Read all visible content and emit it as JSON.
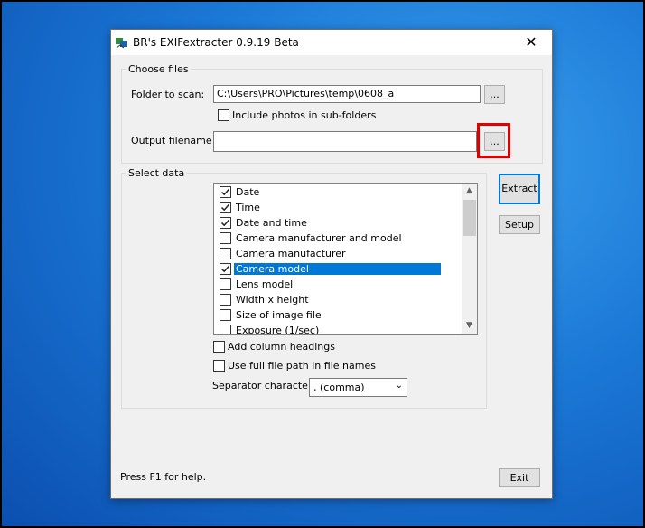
{
  "window": {
    "title": "BR's EXIFextracter 0.9.19 Beta",
    "close_glyph": "✕"
  },
  "choose_files": {
    "group_label": "Choose files",
    "folder_label": "Folder to scan:",
    "folder_value": "C:\\Users\\PRO\\Pictures\\temp\\0608_a",
    "browse_label": "...",
    "include_subfolders_label": "Include photos in sub-folders",
    "include_subfolders_checked": false,
    "output_label": "Output filename :",
    "output_value": "",
    "output_browse_label": "..."
  },
  "select_data": {
    "group_label": "Select data",
    "items": [
      {
        "label": "Date",
        "checked": true,
        "selected": false
      },
      {
        "label": "Time",
        "checked": true,
        "selected": false
      },
      {
        "label": "Date and time",
        "checked": true,
        "selected": false
      },
      {
        "label": "Camera manufacturer and model",
        "checked": false,
        "selected": false
      },
      {
        "label": "Camera manufacturer",
        "checked": false,
        "selected": false
      },
      {
        "label": "Camera model",
        "checked": true,
        "selected": true
      },
      {
        "label": "Lens model",
        "checked": false,
        "selected": false
      },
      {
        "label": "Width x height",
        "checked": false,
        "selected": false
      },
      {
        "label": "Size of image file",
        "checked": false,
        "selected": false
      },
      {
        "label": "Exposure (1/sec)",
        "checked": false,
        "selected": false
      }
    ],
    "add_column_headings_label": "Add column headings",
    "full_path_label": "Use full file path in file names",
    "separator_label": "Separator character:",
    "separator_value": ", (comma)"
  },
  "buttons": {
    "extract_label": "Extract",
    "setup_label": "Setup",
    "exit_label": "Exit"
  },
  "status": {
    "help_text": "Press F1 for help."
  },
  "colors": {
    "highlight_box": "#e00000",
    "selection": "#0078d7"
  }
}
